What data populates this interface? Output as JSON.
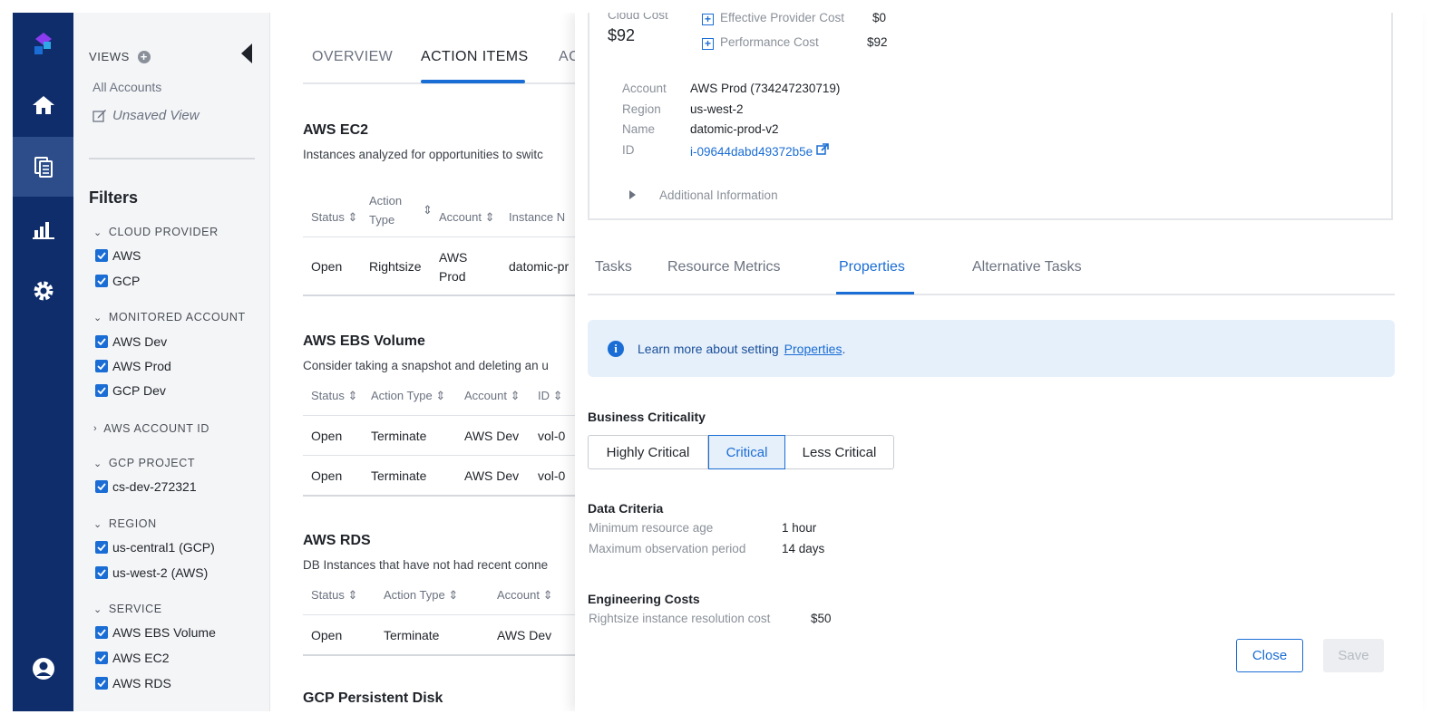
{
  "nav": {
    "items": [
      "logo",
      "home",
      "documents",
      "reports",
      "settings",
      "account"
    ],
    "active": "documents"
  },
  "filters": {
    "views_label": "VIEWS",
    "all_accounts": "All Accounts",
    "unsaved_view": "Unsaved View",
    "title": "Filters",
    "sections": {
      "cloud_provider": {
        "label": "CLOUD PROVIDER",
        "options": [
          "AWS",
          "GCP"
        ]
      },
      "monitored_account": {
        "label": "MONITORED ACCOUNT",
        "options": [
          "AWS Dev",
          "AWS Prod",
          "GCP Dev"
        ]
      },
      "aws_account_id": {
        "label": "AWS ACCOUNT ID"
      },
      "gcp_project": {
        "label": "GCP PROJECT",
        "options": [
          "cs-dev-272321"
        ]
      },
      "region": {
        "label": "REGION",
        "options": [
          "us-central1 (GCP)",
          "us-west-2 (AWS)"
        ]
      },
      "service": {
        "label": "SERVICE",
        "options": [
          "AWS EBS Volume",
          "AWS EC2",
          "AWS RDS"
        ]
      }
    }
  },
  "main": {
    "tabs": [
      "OVERVIEW",
      "ACTION ITEMS",
      "AC"
    ],
    "active_tab": "ACTION ITEMS",
    "ec2": {
      "title": "AWS EC2",
      "desc": "Instances analyzed for opportunities to switc",
      "headers": {
        "status": "Status",
        "action_type_1": "Action",
        "action_type_2": "Type",
        "account": "Account",
        "instance": "Instance N"
      },
      "row": {
        "status": "Open",
        "action": "Rightsize",
        "account_1": "AWS",
        "account_2": "Prod",
        "instance": "datomic-pr"
      }
    },
    "ebs": {
      "title": "AWS EBS Volume",
      "desc": "Consider taking a snapshot and deleting an u",
      "headers": {
        "status": "Status",
        "action_type": "Action Type",
        "account": "Account",
        "id": "ID"
      },
      "rows": [
        {
          "status": "Open",
          "action": "Terminate",
          "account": "AWS Dev",
          "id": "vol-0"
        },
        {
          "status": "Open",
          "action": "Terminate",
          "account": "AWS Dev",
          "id": "vol-0"
        }
      ]
    },
    "rds": {
      "title": "AWS RDS",
      "desc": "DB Instances that have not had recent conne",
      "headers": {
        "status": "Status",
        "action_type": "Action Type",
        "account": "Account"
      },
      "row": {
        "status": "Open",
        "action": "Terminate",
        "account": "AWS Dev"
      }
    },
    "next_title": "GCP Persistent Disk"
  },
  "drawer": {
    "cloud_cost_label": "Cloud Cost",
    "cloud_cost_value": "$92",
    "effective_provider_cost_label": "Effective Provider Cost",
    "effective_provider_cost_value": "$0",
    "performance_cost_label": "Performance Cost",
    "performance_cost_value": "$92",
    "details": {
      "account_label": "Account",
      "account_value": "AWS Prod (734247230719)",
      "region_label": "Region",
      "region_value": "us-west-2",
      "name_label": "Name",
      "name_value": "datomic-prod-v2",
      "id_label": "ID",
      "id_value": "i-09644dabd49372b5e"
    },
    "additional_info": "Additional Information",
    "tabs": [
      "Tasks",
      "Resource Metrics",
      "Properties",
      "Alternative Tasks"
    ],
    "active_tab": "Properties",
    "info_text": "Learn more about setting",
    "info_link": "Properties",
    "business_criticality": {
      "label": "Business Criticality",
      "options": [
        "Highly Critical",
        "Critical",
        "Less Critical"
      ],
      "selected": "Critical"
    },
    "data_criteria": {
      "label": "Data Criteria",
      "min_age_label": "Minimum resource age",
      "min_age_value": "1 hour",
      "max_obs_label": "Maximum observation period",
      "max_obs_value": "14 days"
    },
    "engineering_costs": {
      "label": "Engineering Costs",
      "rightsize_label": "Rightsize instance resolution cost",
      "rightsize_value": "$50"
    },
    "close_label": "Close",
    "save_label": "Save"
  },
  "colors": {
    "rail": "#0e2d6a",
    "accent": "#1a6dd4",
    "info_bg": "#e6f0fb"
  }
}
